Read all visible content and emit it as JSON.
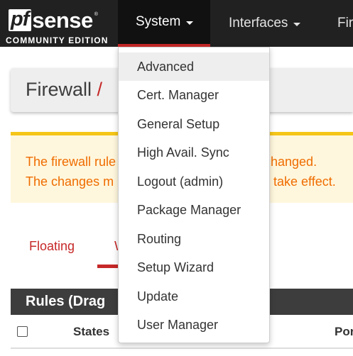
{
  "brand": {
    "logo_pf": "pf",
    "logo_sense": "sense",
    "logo_reg": "®",
    "edition": "COMMUNITY EDITION"
  },
  "nav": {
    "items": [
      {
        "label": "System",
        "active": true
      },
      {
        "label": "Interfaces",
        "active": false
      },
      {
        "label": "Fir",
        "active": false
      }
    ]
  },
  "breadcrumb": {
    "title": "Firewall",
    "separator": "/"
  },
  "alert": {
    "line1_start": "The firewall rule",
    "line1_end": "hanged.",
    "line2_start": "The changes m",
    "line2_end": "take effect."
  },
  "tabs": [
    {
      "label": "Floating"
    },
    {
      "label": "W"
    }
  ],
  "rules_panel": {
    "title": "Rules (Drag",
    "columns": {
      "states": "States",
      "port": "Por"
    }
  },
  "system_menu": {
    "items": [
      {
        "label": "Advanced"
      },
      {
        "label": "Cert. Manager"
      },
      {
        "label": "General Setup"
      },
      {
        "label": "High Avail. Sync"
      },
      {
        "label": "Logout (admin)"
      },
      {
        "label": "Package Manager"
      },
      {
        "label": "Routing"
      },
      {
        "label": "Setup Wizard"
      },
      {
        "label": "Update"
      },
      {
        "label": "User Manager"
      }
    ]
  },
  "colors": {
    "navbar": "#212121",
    "accent_red": "#c62828",
    "alert_text": "#ef6c00",
    "alert_bg": "#fff7dd",
    "alert_border": "#f5c518",
    "panel_header": "#3d3d3d"
  }
}
